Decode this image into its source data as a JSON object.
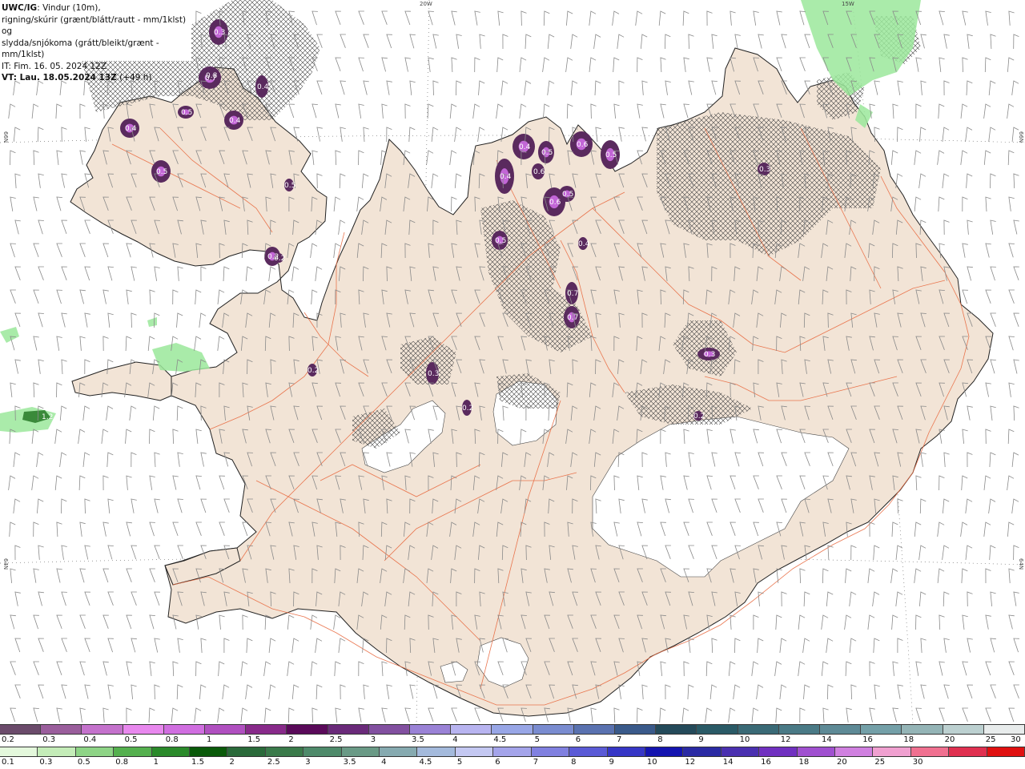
{
  "header": {
    "model": "UWC/IG",
    "line1": ": Vindur (10m),",
    "line2": "rigning/skúrir (grænt/blátt/rautt - mm/1klst) og",
    "line3": "slydda/snjókoma (grátt/bleikt/grænt - mm/1klst)",
    "init_time": "IT: Fim. 16. 05. 2024 12Z",
    "valid_time": "VT: Lau. 18.05.2024 13Z",
    "lead_time": " (+49 h)"
  },
  "graticule": {
    "lon_labels": [
      "20W",
      "15W"
    ],
    "lat_labels_left": [
      "66N",
      "64N"
    ],
    "lat_labels_right": [
      "66N",
      "64N"
    ]
  },
  "colors": {
    "land": "#f2e4d6",
    "roads": "#e8693f",
    "coast": "#222222",
    "wind_barb": "#8a8a8a",
    "hatch": "#444444",
    "snow_purple": "#5a2a5e",
    "snow_magenta": "#c266d6",
    "rain_green": "#9be89b"
  },
  "precip_labels": [
    "0.3",
    "0.7",
    "0.4",
    "0.5",
    "0.4",
    "0.4",
    "0.5",
    "0.5",
    "0.2",
    "0.8",
    "0.4",
    "0.5",
    "0.6",
    "0.4",
    "0.6",
    "0.5",
    "0.6",
    "0.5",
    "0.5",
    "0.4",
    "0.7",
    "0.7",
    "0.3",
    "0.3",
    "0.2",
    "0.2",
    "0.3",
    "0.2",
    "0.2",
    "1.2"
  ],
  "legend_snow": {
    "colors": [
      "#6b4b6b",
      "#9a5e9c",
      "#c472cc",
      "#e888ee",
      "#d06ee0",
      "#b050c0",
      "#882a8a",
      "#5a0a5a",
      "#6a2a7a",
      "#8250a0",
      "#9a82d6",
      "#b8b4f0",
      "#98a6e6",
      "#7a8cd0",
      "#5a72b0",
      "#3a5a8a",
      "#244a5a",
      "#2a5a66",
      "#3a6a76",
      "#4a7a86",
      "#5e8a96",
      "#74a0a8",
      "#94b4b6",
      "#bcd0d0",
      "#e8ecec"
    ],
    "labels": [
      "0.2",
      "0.3",
      "0.4",
      "0.5",
      "0.8",
      "1",
      "1.5",
      "2",
      "2.5",
      "3",
      "3.5",
      "4",
      "4.5",
      "5",
      "6",
      "7",
      "8",
      "9",
      "10",
      "12",
      "14",
      "16",
      "18",
      "20",
      "25",
      "30"
    ]
  },
  "legend_rain": {
    "colors": [
      "#e4f8dc",
      "#c4ecb8",
      "#8ed486",
      "#54b04e",
      "#2a8a2a",
      "#0a5a0a",
      "#2a6a3a",
      "#3a7a4a",
      "#4e8a6a",
      "#6a9a86",
      "#86aab0",
      "#a4badc",
      "#c4c8f2",
      "#a4a4ea",
      "#8080e0",
      "#5a5ad6",
      "#3636c6",
      "#1414b0",
      "#2a2aa4",
      "#4a30b0",
      "#7030c0",
      "#a050d0",
      "#d080e0",
      "#f0a0d0",
      "#f07090",
      "#e03050",
      "#e01010"
    ],
    "labels": [
      "0.1",
      "0.3",
      "0.5",
      "0.8",
      "1",
      "1.5",
      "2",
      "2.5",
      "3",
      "3.5",
      "4",
      "4.5",
      "5",
      "6",
      "7",
      "8",
      "9",
      "10",
      "12",
      "14",
      "16",
      "18",
      "20",
      "25",
      "30"
    ]
  }
}
